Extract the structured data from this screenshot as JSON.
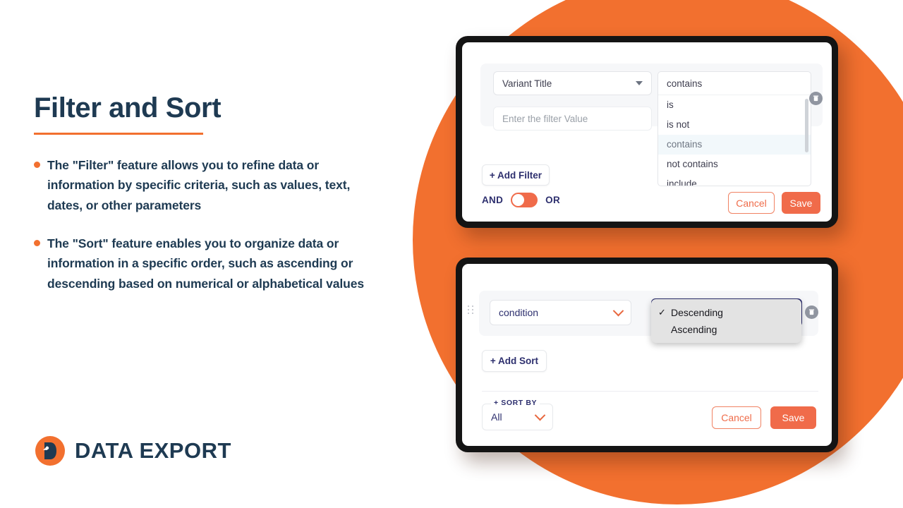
{
  "page": {
    "title": "Filter and Sort",
    "bullets": [
      "The \"Filter\" feature allows you to refine data or information by specific criteria, such as values, text, dates, or other parameters",
      "The \"Sort\" feature enables you to organize data or information in a specific order, such as ascending or descending based on numerical or alphabetical values"
    ]
  },
  "logo": {
    "text": "DATA EXPORT",
    "mark_icon": "d-monogram-icon"
  },
  "colors": {
    "brand_orange": "#f2702f",
    "accent_coral": "#f06b4a",
    "navy": "#1e3a52",
    "indigo": "#2d2f6e"
  },
  "filter_card": {
    "field_select": {
      "value": "Variant Title",
      "icon": "caret-down-icon"
    },
    "value_input": {
      "placeholder": "Enter the filter Value",
      "value": ""
    },
    "operator_combo": {
      "selected": "contains",
      "options": [
        "is",
        "is not",
        "contains",
        "not contains",
        "include"
      ],
      "highlighted": "contains"
    },
    "add_filter_label": "+ Add Filter",
    "logic_toggle": {
      "left_label": "AND",
      "right_label": "OR",
      "selected": "AND"
    },
    "cancel_label": "Cancel",
    "save_label": "Save",
    "delete_icon": "trash-icon"
  },
  "sort_card": {
    "condition_select": {
      "value": "condition",
      "icon": "chevron-down-icon"
    },
    "direction_popup": {
      "options": [
        "Descending",
        "Ascending"
      ],
      "selected": "Descending",
      "check_icon": "check-icon"
    },
    "add_sort_label": "+ Add Sort",
    "sort_by": {
      "legend": "+ SORT BY",
      "value": "All",
      "icon": "chevron-down-icon"
    },
    "cancel_label": "Cancel",
    "save_label": "Save",
    "delete_icon": "trash-icon",
    "drag_handle_icon": "drag-handle-icon"
  }
}
